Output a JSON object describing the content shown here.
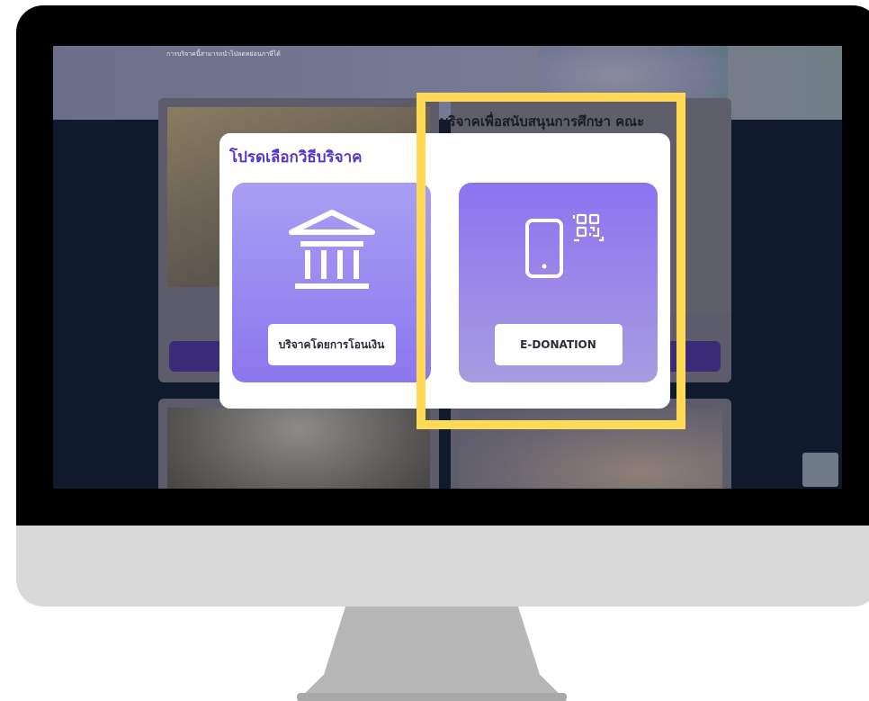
{
  "page": {
    "hero_text": "การบริจาคนี้สามารถนำไปลดหย่อนภาษีได้",
    "card_title": "บริจาคเพื่อสนับสนุนการศึกษา คณะ"
  },
  "modal": {
    "title": "โปรดเลือกวิธีบริจาค",
    "options": [
      {
        "label": "บริจาคโดยการโอนเงิน",
        "icon": "bank-icon"
      },
      {
        "label": "E-DONATION",
        "icon": "phone-qr-icon"
      }
    ]
  },
  "colors": {
    "accent": "#5535c8",
    "highlight": "#ffda55",
    "option_gradient_top": "#a89ff3",
    "option_gradient_bottom": "#8c76ee"
  }
}
